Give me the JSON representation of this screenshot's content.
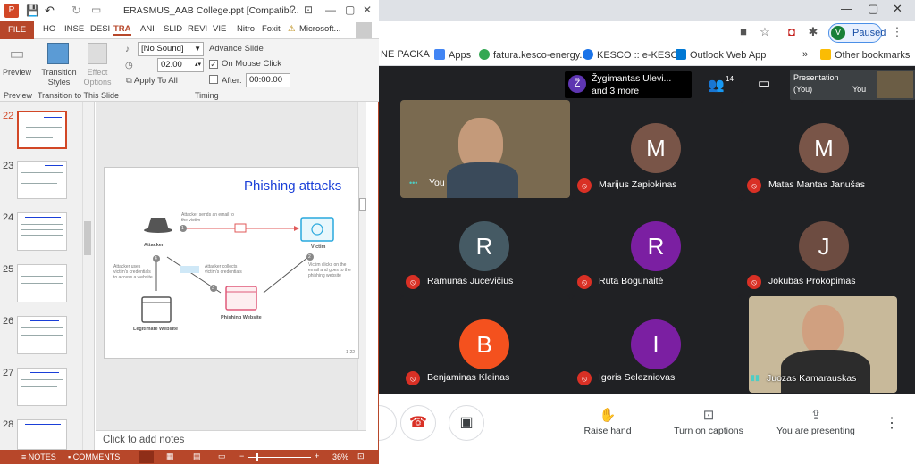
{
  "chrome": {
    "paused_label": "Paused",
    "profile_initial": "V",
    "bookmarks": [
      {
        "label": "NE PACKA",
        "color": "#fbbc04"
      },
      {
        "label": "Apps",
        "color": "#4285f4"
      },
      {
        "label": "fatura.kesco-energy....",
        "color": "#34a853"
      },
      {
        "label": "KESCO :: e-KESCO",
        "color": "#1a73e8"
      },
      {
        "label": "Outlook Web App",
        "color": "#0078d4"
      }
    ],
    "more_bookmarks": "»",
    "other_bookmarks": "Other bookmarks"
  },
  "meet": {
    "speaker_initial": "Ž",
    "speaker_name": "Žygimantas Ulevi...",
    "speaker_more": "and 3 more",
    "people_count": "14",
    "presentation_label": "Presentation",
    "presentation_sub": "(You)",
    "you_label": "You",
    "participants": [
      {
        "name": "You",
        "initial": "",
        "color": "#6b5d45",
        "muted": false
      },
      {
        "name": "Marijus Zapiokinas",
        "initial": "M",
        "color": "#795548",
        "muted": true
      },
      {
        "name": "Matas Mantas Janušas",
        "initial": "M",
        "color": "#795548",
        "muted": true
      },
      {
        "name": "Ramūnas Jucevičius",
        "initial": "R",
        "color": "#455a64",
        "muted": true
      },
      {
        "name": "Rūta Bogunaitė",
        "initial": "R",
        "color": "#7b1fa2",
        "muted": true
      },
      {
        "name": "Jokūbas Prokopimas",
        "initial": "J",
        "color": "#6d4c41",
        "muted": true
      },
      {
        "name": "Benjaminas Kleinas",
        "initial": "B",
        "color": "#f4511e",
        "muted": true
      },
      {
        "name": "Igoris Selezniovas",
        "initial": "I",
        "color": "#7b1fa2",
        "muted": true
      },
      {
        "name": "Juozas Kamarauskas",
        "initial": "",
        "color": "#8a8070",
        "muted": false
      }
    ],
    "controls": {
      "raise_hand": "Raise hand",
      "captions": "Turn on captions",
      "presenting": "You are presenting"
    }
  },
  "ppt": {
    "window_title": "ERASMUS_AAB College.ppt [Compatibi...",
    "tabs": [
      "FILE",
      "HO",
      "INSE",
      "DESI",
      "TRA",
      "ANI",
      "SLID",
      "REVI",
      "VIE",
      "Nitro",
      "Foxit",
      "Microsoft..."
    ],
    "ribbon": {
      "preview": "Preview",
      "transition_styles": "Transition Styles",
      "effect_options": "Effect Options",
      "sound": "[No Sound]",
      "duration": "02.00",
      "apply_to_all": "Apply To All",
      "advance_slide": "Advance Slide",
      "on_mouse_click": "On Mouse Click",
      "after": "After:",
      "after_value": "00:00.00",
      "group_preview": "Preview",
      "group_transition": "Transition to This Slide",
      "group_timing": "Timing"
    },
    "slide_numbers": [
      "22",
      "23",
      "24",
      "25",
      "26",
      "27",
      "28"
    ],
    "slide": {
      "title": "Phishing attacks",
      "attacker": "Attacker",
      "victim": "Victim",
      "legit_site": "Legitimate Website",
      "phish_site": "Phishing Website",
      "step1": "Attacker sends an email to the victim",
      "step2": "Victim clicks on the email and goes to the phishing website",
      "step3": "Attacker collects victim's credentials",
      "step4": "Attacker uses victim's credentials to access a website",
      "n1": "1",
      "n2": "2",
      "n3": "3",
      "n4": "4",
      "page": "1-22"
    },
    "notes_placeholder": "Click to add notes",
    "status": {
      "notes": "NOTES",
      "comments": "COMMENTS",
      "zoom": "36%"
    }
  }
}
